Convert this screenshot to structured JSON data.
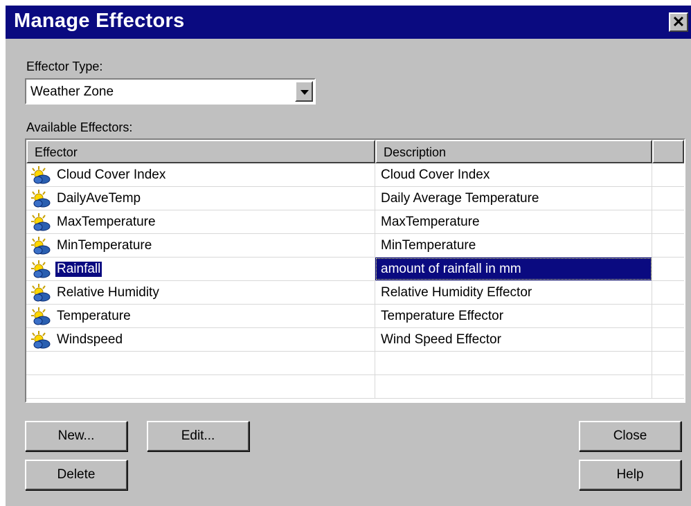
{
  "window": {
    "title": "Manage Effectors",
    "close_glyph": "✕"
  },
  "effector_type": {
    "label": "Effector Type:",
    "value": "Weather Zone"
  },
  "available": {
    "label": "Available Effectors:",
    "columns": [
      "Effector",
      "Description"
    ],
    "rows": [
      {
        "name": "Cloud Cover Index",
        "description": "Cloud Cover Index",
        "icon": "weather-sun-cloud-icon"
      },
      {
        "name": "DailyAveTemp",
        "description": "Daily Average Temperature",
        "icon": "weather-sun-cloud-icon"
      },
      {
        "name": "MaxTemperature",
        "description": "MaxTemperature",
        "icon": "weather-sun-cloud-icon"
      },
      {
        "name": "MinTemperature",
        "description": "MinTemperature",
        "icon": "weather-sun-cloud-icon"
      },
      {
        "name": "Rainfall",
        "description": "amount of rainfall in mm",
        "icon": "weather-sun-cloud-icon",
        "selected": true
      },
      {
        "name": "Relative Humidity",
        "description": "Relative Humidity Effector",
        "icon": "weather-sun-cloud-icon"
      },
      {
        "name": "Temperature",
        "description": "Temperature Effector",
        "icon": "weather-sun-cloud-icon"
      },
      {
        "name": "Windspeed",
        "description": "Wind Speed Effector",
        "icon": "weather-sun-cloud-icon"
      }
    ]
  },
  "buttons": {
    "new": "New...",
    "edit": "Edit...",
    "delete": "Delete",
    "close": "Close",
    "help": "Help"
  },
  "colors": {
    "titlebar": "#0a0a80",
    "selection": "#0a0a80",
    "face": "#c0c0c0"
  }
}
